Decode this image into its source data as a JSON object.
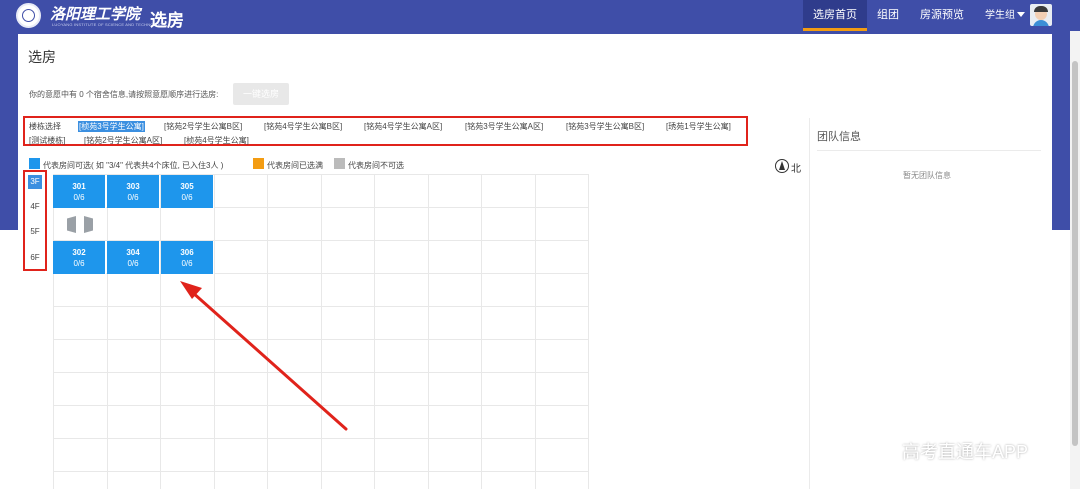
{
  "header": {
    "school_name": "洛阳理工学院",
    "school_english": "LUOYANG INSTITUTE OF SCIENCE AND TECHNOLOGY",
    "app_title": "选房",
    "nav": [
      "选房首页",
      "组团",
      "房源预览"
    ],
    "active_nav": "选房首页",
    "user_name": "学生组",
    "brand_color": "#3f4ea8"
  },
  "main": {
    "page_title": "选房",
    "hint": "你的意愿中有 0 个宿舍信息,请按照意愿顺序进行选房:",
    "confirm_button": "一键选房",
    "building_label": "楼栋选择",
    "buildings": [
      "[桢苑3号学生公寓]",
      "[铭苑2号学生公寓B区]",
      "[铭苑4号学生公寓B区]",
      "[铭苑4号学生公寓A区]",
      "[铭苑3号学生公寓A区]",
      "[铭苑3号学生公寓B区]",
      "[琇苑1号学生公寓]",
      "[测试楼栋]",
      "[铭苑2号学生公寓A区]",
      "[桢苑4号学生公寓]"
    ],
    "selected_building": "[桢苑3号学生公寓]",
    "legend": [
      {
        "label": "代表房间可选( 如 \"3/4\" 代表共4个床位, 已入住3人 )",
        "color": "#1e96ec"
      },
      {
        "label": "代表房间已选满",
        "color": "#f39c12"
      },
      {
        "label": "代表房间不可选",
        "color": "#bbbbbb"
      }
    ],
    "floors": [
      "3F",
      "4F",
      "5F",
      "6F"
    ],
    "selected_floor": "3F",
    "rooms_top": [
      {
        "number": "301",
        "occupancy": "0/6"
      },
      {
        "number": "303",
        "occupancy": "0/6"
      },
      {
        "number": "305",
        "occupancy": "0/6"
      }
    ],
    "rooms_bottom": [
      {
        "number": "302",
        "occupancy": "0/6"
      },
      {
        "number": "304",
        "occupancy": "0/6"
      },
      {
        "number": "306",
        "occupancy": "0/6"
      }
    ],
    "compass_label": "北"
  },
  "team": {
    "title": "团队信息",
    "empty": "暂无团队信息"
  },
  "watermark": "高考直通车APP",
  "annotation_color": "#e0231b"
}
